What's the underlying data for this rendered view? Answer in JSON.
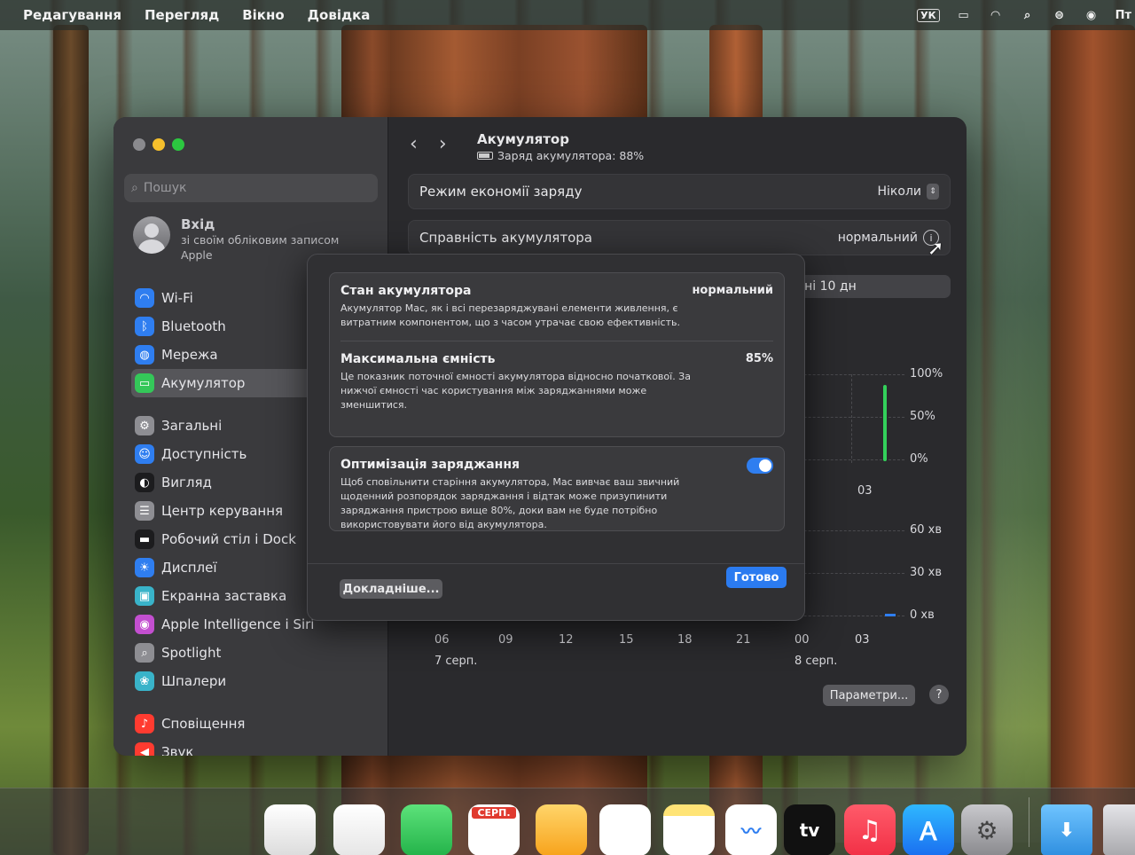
{
  "menubar": {
    "items": [
      "Редагування",
      "Перегляд",
      "Вікно",
      "Довідка"
    ],
    "input_source": "УК",
    "clock": "Пт"
  },
  "sidebar": {
    "search_placeholder": "Пошук",
    "account": {
      "title": "Вхід",
      "line1": "зі своїм обліковим записом",
      "line2": "Apple"
    },
    "items": [
      {
        "label": "Wi-Fi",
        "icon": "wifi-icon",
        "color": "#2f7ef0"
      },
      {
        "label": "Bluetooth",
        "icon": "bluetooth-icon",
        "color": "#2f7ef0"
      },
      {
        "label": "Мережа",
        "icon": "network-globe-icon",
        "color": "#2f7ef0"
      },
      {
        "label": "Акумулятор",
        "icon": "battery-icon",
        "color": "#34c759",
        "active": true
      },
      {
        "label": "Загальні",
        "icon": "gear-icon",
        "color": "#8e8e93"
      },
      {
        "label": "Доступність",
        "icon": "accessibility-icon",
        "color": "#2f7ef0"
      },
      {
        "label": "Вигляд",
        "icon": "appearance-icon",
        "color": "#1c1c1e"
      },
      {
        "label": "Центр керування",
        "icon": "control-center-icon",
        "color": "#8e8e93"
      },
      {
        "label": "Робочий стіл і Dock",
        "icon": "desktop-dock-icon",
        "color": "#1c1c1e"
      },
      {
        "label": "Дисплеї",
        "icon": "display-brightness-icon",
        "color": "#2f7ef0"
      },
      {
        "label": "Екранна заставка",
        "icon": "screensaver-icon",
        "color": "#39b3c9"
      },
      {
        "label": "Apple Intelligence і Siri",
        "icon": "siri-icon",
        "color": "#c34fd0"
      },
      {
        "label": "Spotlight",
        "icon": "spotlight-search-icon",
        "color": "#8e8e93"
      },
      {
        "label": "Шпалери",
        "icon": "wallpaper-icon",
        "color": "#39b3c9"
      },
      {
        "label": "Сповіщення",
        "icon": "notifications-bell-icon",
        "color": "#ff3b30"
      },
      {
        "label": "Звук",
        "icon": "sound-speaker-icon",
        "color": "#ff3b30"
      }
    ]
  },
  "main": {
    "title": "Акумулятор",
    "subtitle": "Заряд акумулятора: 88%",
    "low_power": {
      "label": "Режим економії заряду",
      "value": "Ніколи"
    },
    "health": {
      "label": "Справність акумулятора",
      "value": "нормальний"
    },
    "range_tab": "нні 10 дн",
    "chart_ticks_level": [
      "100%",
      "50%",
      "0%"
    ],
    "chart_ticks_time": [
      "60 хв",
      "30 хв",
      "0 хв"
    ],
    "x_labels": [
      "06",
      "09",
      "12",
      "15",
      "18",
      "21",
      "00",
      "03"
    ],
    "date_left": "7 серп.",
    "date_right": "8 серп.",
    "upper_x_label": "03",
    "params_button": "Параметри...",
    "help_button": "?"
  },
  "sheet": {
    "condition": {
      "title": "Стан акумулятора",
      "value": "нормальний",
      "desc": "Акумулятор Mac, як і всі перезаряджувані елементи живлення, є витратним компонентом, що з часом утрачає свою ефективність."
    },
    "capacity": {
      "title": "Максимальна ємність",
      "value": "85%",
      "desc": "Це показник поточної ємності акумулятора відносно початкової. За нижчої ємності час користування між заряджаннями може зменшитися."
    },
    "optimize": {
      "title": "Оптимізація заряджання",
      "enabled": true,
      "desc": "Щоб сповільнити старіння акумулятора, Mac вивчає ваш звичний щоденний розпорядок заряджання і відтак може призупинити заряджання пристрою вище 80%, доки вам не буде потрібно використовувати його від акумулятора."
    },
    "more_button": "Докладніше...",
    "done_button": "Готово"
  },
  "dock": {
    "calendar_month": "СЕРП.",
    "tv_label": "tv"
  }
}
